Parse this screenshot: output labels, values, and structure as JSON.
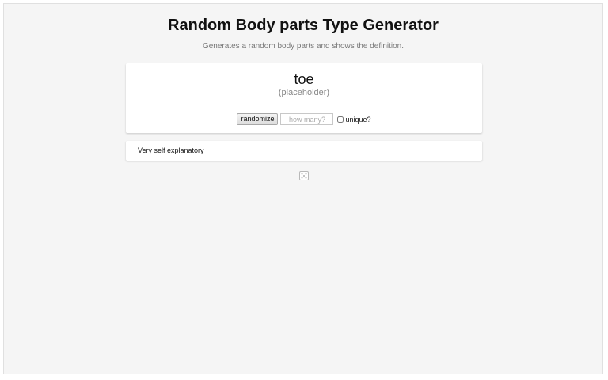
{
  "header": {
    "title": "Random Body parts Type Generator",
    "subtitle": "Generates a random body parts and shows the definition."
  },
  "result": {
    "word": "toe",
    "definition": "(placeholder)"
  },
  "controls": {
    "randomize_label": "randomize",
    "count_placeholder": "how many?",
    "count_value": "",
    "unique_label": "unique?",
    "unique_checked": false
  },
  "description": {
    "text": "Very self explanatory"
  },
  "icons": {
    "dice": "dice-icon"
  },
  "colors": {
    "background": "#f5f5f5",
    "card": "#ffffff",
    "muted_text": "#888888"
  }
}
